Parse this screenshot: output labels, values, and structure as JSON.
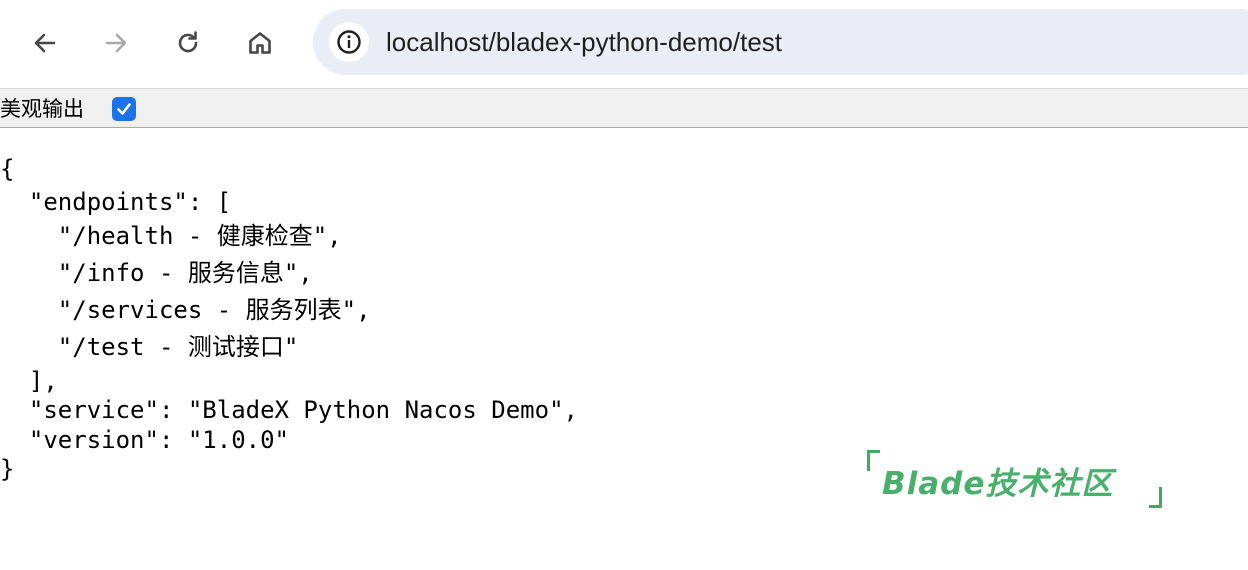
{
  "browser": {
    "url": "localhost/bladex-python-demo/test",
    "icons": {
      "back": "arrow-left-icon",
      "forward": "arrow-right-icon",
      "reload": "reload-icon",
      "home": "home-icon",
      "site_info": "info-icon"
    }
  },
  "json_viewer": {
    "pretty_label": "美观输出",
    "pretty_checked": true,
    "lines": [
      "{",
      "  \"endpoints\": [",
      "    \"/health - 健康检查\",",
      "    \"/info - 服务信息\",",
      "    \"/services - 服务列表\",",
      "    \"/test - 测试接口\"",
      "  ],",
      "  \"service\": \"BladeX Python Nacos Demo\",",
      "  \"version\": \"1.0.0\"",
      "}"
    ]
  },
  "watermark": {
    "text": "Blade技术社区",
    "color": "#49b06b"
  },
  "colors": {
    "accent": "#1a73e8",
    "omnibox": "#e9eef6",
    "icon": "#474747",
    "icon_disabled": "#a9a9a9"
  }
}
